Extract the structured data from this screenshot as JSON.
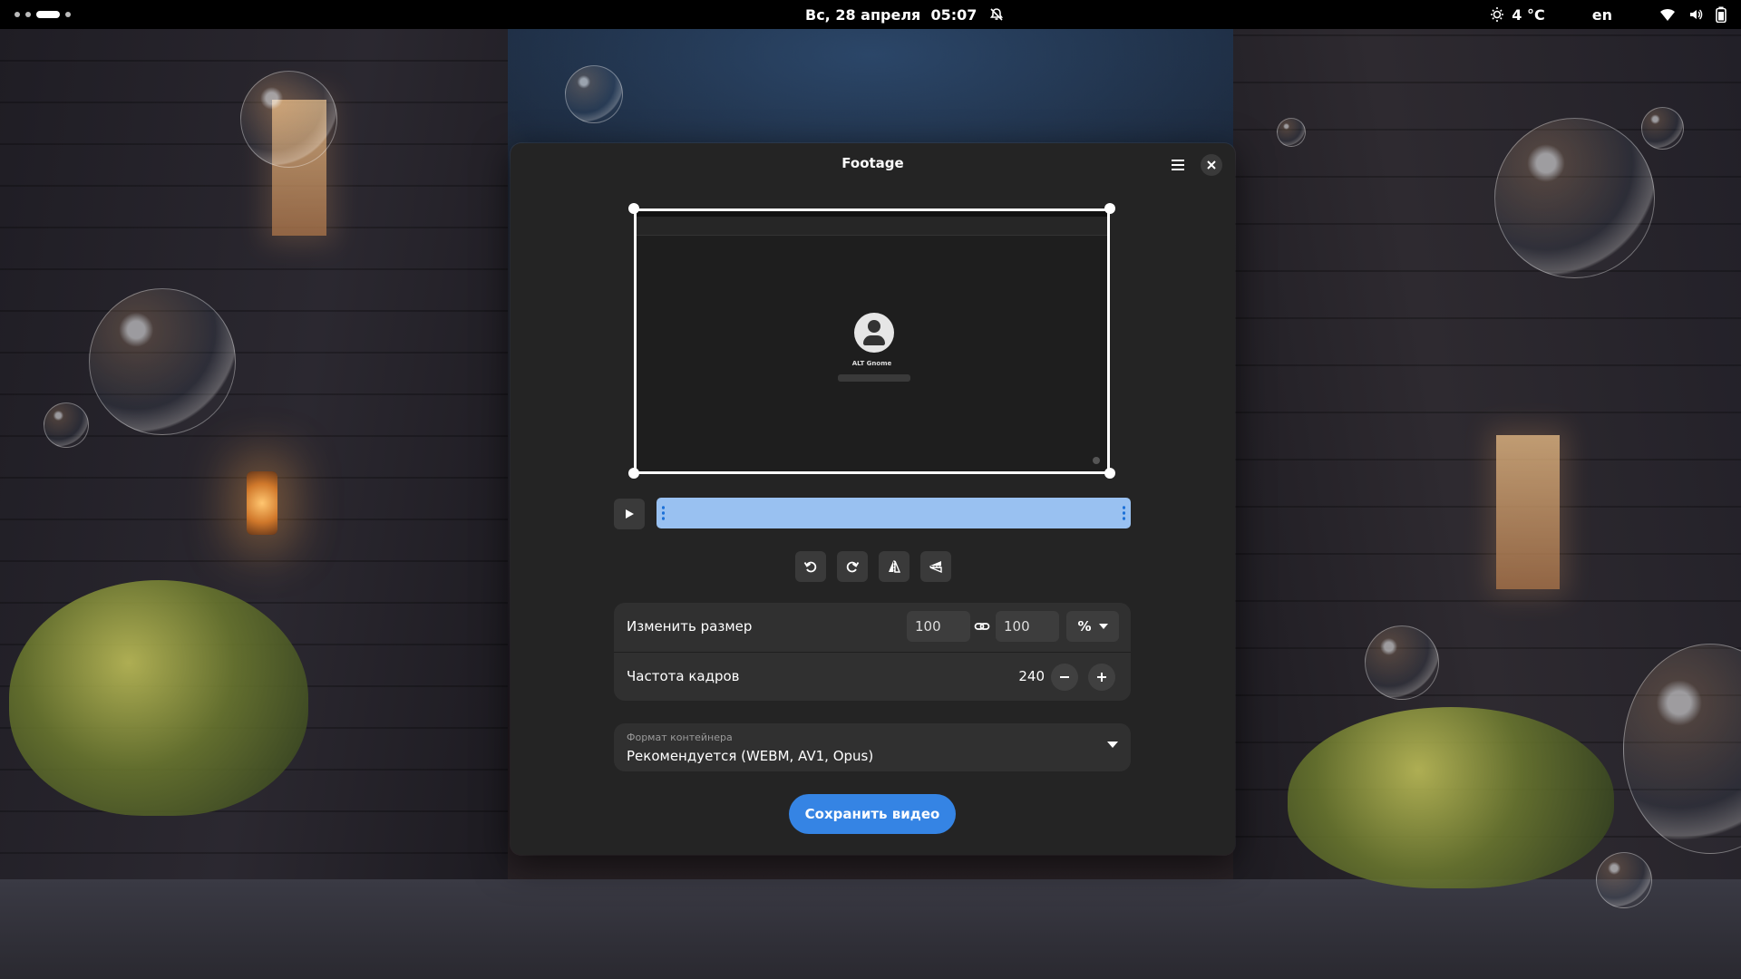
{
  "topbar": {
    "datetime": "Вс, 28 апреля  05:07",
    "weather": "4 °C",
    "keyboard_layout": "en"
  },
  "window": {
    "title": "Footage",
    "preview": {
      "user_name": "ALT Gnome"
    },
    "resize": {
      "label": "Изменить размер",
      "width": "100",
      "height": "100",
      "unit": "%"
    },
    "framerate": {
      "label": "Частота кадров",
      "value": "240"
    },
    "container": {
      "subtitle": "Формат контейнера",
      "value": "Рекомендуется (WEBM, AV1, Opus)"
    },
    "save_label": "Сохранить видео"
  },
  "colors": {
    "accent": "#3584e4",
    "timeline": "#99c1f1",
    "window_bg": "#242424",
    "row_bg": "#303030"
  }
}
